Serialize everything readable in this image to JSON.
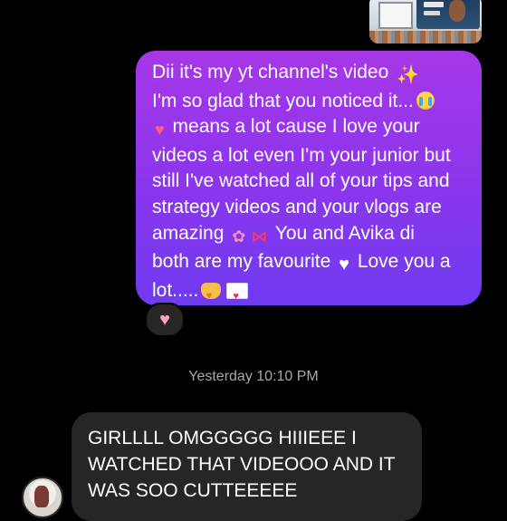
{
  "thread": {
    "outgoing_message": {
      "lines": [
        {
          "text": "Dii it's my yt channel's video",
          "emoji_after": "sparkles-icon"
        },
        {
          "text": "I'm so glad that you noticed it...",
          "emoji_after": "loudly-crying-face-icon"
        },
        {
          "emoji_before": "heart-icon",
          "text": " means a lot cause I love your"
        },
        {
          "text": "videos a lot even I'm your junior but"
        },
        {
          "text": "still I've watched all of your tips and"
        },
        {
          "text": "strategy videos and your vlogs are"
        },
        {
          "text": "amazing",
          "emojis_after": [
            "tulip-icon",
            "ribbon-icon"
          ],
          "text_after": " You and Avika di"
        },
        {
          "text": "both are my favourite",
          "emoji_after": "white-heart-icon",
          "text_after": " Love you a"
        },
        {
          "text": "lot.....",
          "emojis_after": [
            "heart-hands-icon",
            "love-letter-icon"
          ]
        }
      ],
      "color_top": "#a637e8",
      "color_bottom": "#6f3bf1"
    },
    "reaction": {
      "icon": "pink-heart-icon",
      "glyph": "♥"
    },
    "timestamp": "Yesterday 10:10 PM",
    "incoming_message": {
      "lines": [
        "GIRLLLL OMGGGGG HIIIEEE I",
        "WATCHED THAT VIDEOOO AND IT",
        "WAS SOO CUTTEEEEE"
      ],
      "color": "#262626"
    },
    "shared_media": {
      "type": "video-thumbnail"
    },
    "sender_avatar": {
      "type": "avatar"
    }
  }
}
